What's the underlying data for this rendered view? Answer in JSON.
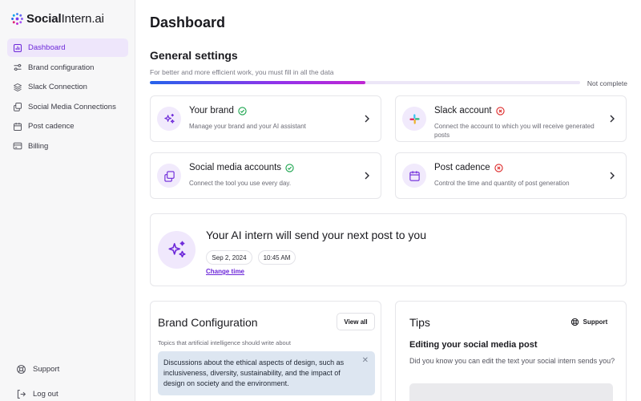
{
  "brand": {
    "name_bold": "Social",
    "name_rest": "Intern.ai"
  },
  "sidebar": {
    "items": [
      {
        "label": "Dashboard",
        "icon": "chart-icon",
        "active": true
      },
      {
        "label": "Brand configuration",
        "icon": "sliders-icon"
      },
      {
        "label": "Slack Connection",
        "icon": "layers-icon"
      },
      {
        "label": "Social Media Connections",
        "icon": "copy-icon"
      },
      {
        "label": "Post cadence",
        "icon": "calendar-icon"
      },
      {
        "label": "Billing",
        "icon": "credit-card-icon"
      }
    ],
    "support_label": "Support",
    "logout_label": "Log out"
  },
  "header": {
    "title": "Dashboard"
  },
  "general": {
    "title": "General settings",
    "subtitle": "For better and more efficient work, you must fill in all the data",
    "progress": 0.5,
    "status": "Not complete",
    "cards": [
      {
        "title": "Your brand",
        "desc": "Manage your brand and your AI assistant",
        "status": "complete",
        "icon": "sparkles-icon"
      },
      {
        "title": "Slack account",
        "desc": "Connect the account to which you will receive generated posts",
        "status": "incomplete",
        "icon": "slack-icon"
      },
      {
        "title": "Social media accounts",
        "desc": "Connect the tool you use every day.",
        "status": "complete",
        "icon": "copy-icon"
      },
      {
        "title": "Post cadence",
        "desc": "Control the time and quantity of post generation",
        "status": "incomplete",
        "icon": "calendar-icon"
      }
    ]
  },
  "next_post": {
    "title": "Your AI intern will send your next post to you",
    "date": "Sep 2, 2024",
    "time": "10:45 AM",
    "change_label": "Change time"
  },
  "brand_config": {
    "title": "Brand Configuration",
    "view_all": "View all",
    "subtitle": "Topics that artificial intelligence should write about",
    "topic": "Discussions about the ethical aspects of design, such as inclusiveness, diversity, sustainability, and the impact of design on society and the environment."
  },
  "tips": {
    "title": "Tips",
    "support_label": "Support",
    "heading": "Editing your social media post",
    "body": "Did you know you can edit the text your social intern sends you?"
  },
  "colors": {
    "accent": "#6d28d9",
    "accent_bg": "#eee6fb",
    "success": "#16a34a",
    "error": "#dc2626"
  }
}
